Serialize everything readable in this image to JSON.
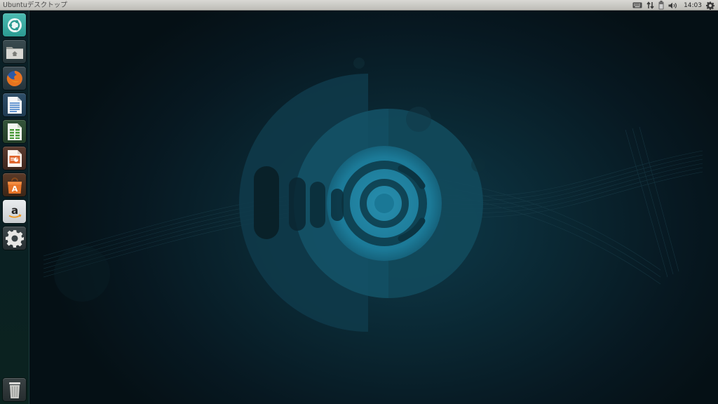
{
  "panel": {
    "window_title": "Ubuntuデスクトップ",
    "clock": "14:03",
    "indicators": [
      "keyboard-icon",
      "network-icon",
      "battery-icon",
      "volume-icon",
      "session-gear-icon"
    ]
  },
  "launcher": {
    "items": [
      {
        "name": "dash-home",
        "icon": "ubuntu-logo-icon"
      },
      {
        "name": "files",
        "icon": "home-folder-icon"
      },
      {
        "name": "firefox",
        "icon": "firefox-icon"
      },
      {
        "name": "libreoffice-writer",
        "icon": "writer-document-icon"
      },
      {
        "name": "libreoffice-calc",
        "icon": "calc-spreadsheet-icon"
      },
      {
        "name": "libreoffice-impress",
        "icon": "impress-presentation-icon"
      },
      {
        "name": "ubuntu-software-center",
        "icon": "software-center-bag-icon"
      },
      {
        "name": "amazon",
        "icon": "amazon-icon"
      },
      {
        "name": "system-settings",
        "icon": "settings-gear-icon"
      }
    ],
    "trash": {
      "name": "trash",
      "icon": "trash-icon"
    }
  },
  "colors": {
    "panel_bg": "#cfcec9",
    "launcher_bg": "#0a1e24",
    "desktop_accent": "#1f7a95",
    "dash_tile": "#3aa8a0"
  }
}
